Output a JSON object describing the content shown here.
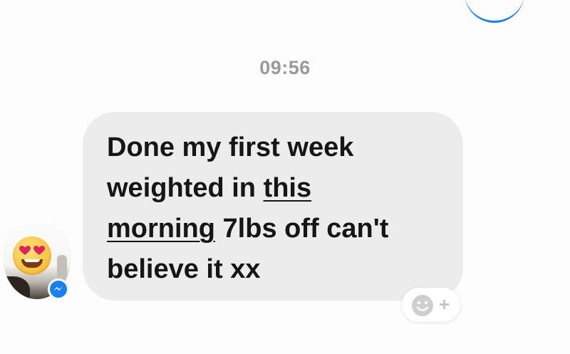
{
  "conversation": {
    "timestamp": "09:56",
    "incoming_message": {
      "lines": [
        {
          "parts": [
            {
              "text": "Done my first week",
              "underline": false
            }
          ]
        },
        {
          "parts": [
            {
              "text": "weighted in ",
              "underline": false
            },
            {
              "text": "this",
              "underline": true
            }
          ]
        },
        {
          "parts": [
            {
              "text": "morning",
              "underline": true
            },
            {
              "text": " 7lbs off can't",
              "underline": false
            }
          ]
        },
        {
          "parts": [
            {
              "text": "believe it xx",
              "underline": false
            }
          ]
        }
      ]
    },
    "sender": {
      "avatar_icon": "heart-eyes-emoji-icon",
      "badge_icon": "messenger-icon"
    },
    "reaction_button": {
      "icon": "smiley-icon",
      "plus": "+"
    }
  },
  "colors": {
    "bubble_background": "#ececec",
    "timestamp": "#9a9a9a",
    "messenger_blue": "#1a80f0",
    "outgoing_bubble": "#1a7fe6"
  }
}
